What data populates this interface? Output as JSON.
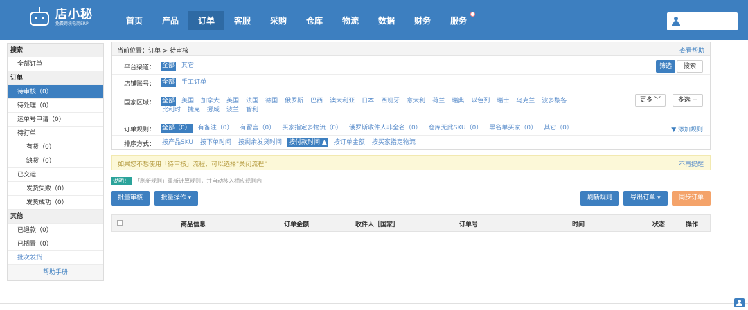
{
  "app": {
    "logo_name": "店小秘",
    "logo_tagline": "免费跨境电商ERP"
  },
  "nav": {
    "items": [
      "首页",
      "产品",
      "订单",
      "客服",
      "采购",
      "仓库",
      "物流",
      "数据",
      "财务",
      "服务"
    ],
    "active": "订单"
  },
  "user": {
    "name": ""
  },
  "sidebar": {
    "search_head": "搜索",
    "all_orders": "全部订单",
    "order_head": "订单",
    "pending_review": "待审核（0）",
    "pending_process": "待处理（0）",
    "tracking_apply": "运单号申请（0）",
    "to_print": "待打单",
    "in_stock": "有货（0）",
    "out_of_stock": "缺货（0）",
    "shipped": "已交运",
    "ship_failed": "发货失败（0）",
    "ship_success": "发货成功（0）",
    "other_head": "其他",
    "refunded": "已退款（0）",
    "ignored": "已搁置（0）",
    "batch_ship": "批次发货",
    "help_manual": "帮助手册"
  },
  "breadcrumb": {
    "text": "当前位置：订单 > 待审核",
    "help_link": "查看帮助"
  },
  "filters": {
    "platform_label": "平台渠道：",
    "platform_options": [
      "全部",
      "其它"
    ],
    "store_label": "店铺账号：",
    "store_options": [
      "全部",
      "手工订单"
    ],
    "country_label": "国家区域：",
    "country_options": [
      "全部",
      "美国",
      "加拿大",
      "英国",
      "法国",
      "德国",
      "俄罗斯",
      "巴西",
      "澳大利亚",
      "日本",
      "西班牙",
      "意大利",
      "荷兰",
      "瑞典",
      "以色列",
      "瑞士",
      "乌克兰",
      "波多黎各",
      "比利时",
      "捷克",
      "挪威",
      "波兰",
      "智利"
    ],
    "more_button": "更多 ﹀",
    "multi_select_button": "多选 +",
    "rule_label": "订单规则：",
    "rule_options": [
      "全部（0）",
      "有备注（0）",
      "有留言（0）",
      "买家指定多物流（0）",
      "俄罗斯收件人非全名（0）",
      "仓库无此SKU（0）",
      "黑名单买家（0）",
      "其它（0）"
    ],
    "add_rule_link": "▼ 添加规则",
    "sort_label": "排序方式：",
    "sort_options": [
      "按产品SKU",
      "按下单时间",
      "按剩余发货时间",
      "按付款时间 ▲",
      "按订单金额",
      "按买家指定物流"
    ],
    "filter_button": "筛选",
    "search_button": "搜索"
  },
  "notice": {
    "text": "如果您不想使用「待审核」流程，可以选择\"关闭流程\"",
    "close_link": "不再提醒"
  },
  "explain": {
    "badge": "说明！",
    "text": "「刷新规则」重新计算规则，并自动移入相应规则内"
  },
  "actions": {
    "batch_review": "批量审核",
    "batch_ops": "批量操作 ▾",
    "refresh_rules": "刷新规则",
    "export_orders": "导出订单 ▾",
    "sync_orders": "同步订单"
  },
  "table": {
    "headers": [
      "商品信息",
      "订单金额",
      "收件人［国家］",
      "订单号",
      "时间",
      "状态",
      "操作"
    ]
  }
}
